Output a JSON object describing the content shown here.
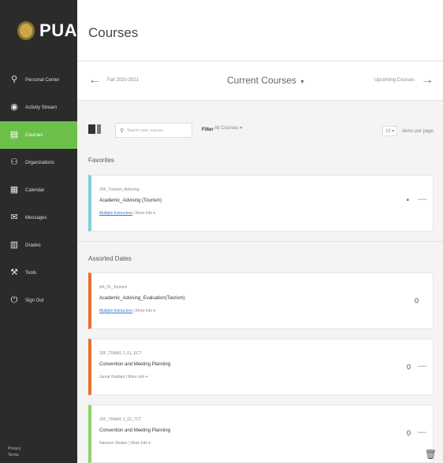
{
  "sidebar": {
    "logo_text": "PUA",
    "items": [
      {
        "label": "Personal Center",
        "icon": "person-icon",
        "glyph": "⚲"
      },
      {
        "label": "Activity Stream",
        "icon": "activity-icon",
        "glyph": "◉"
      },
      {
        "label": "Courses",
        "icon": "book-icon",
        "glyph": "▤"
      },
      {
        "label": "Organizations",
        "icon": "org-icon",
        "glyph": "⚇"
      },
      {
        "label": "Calendar",
        "icon": "calendar-icon",
        "glyph": "▦"
      },
      {
        "label": "Messages",
        "icon": "mail-icon",
        "glyph": "✉"
      },
      {
        "label": "Grades",
        "icon": "grades-icon",
        "glyph": "▥"
      },
      {
        "label": "Tools",
        "icon": "tools-icon",
        "glyph": "⚒"
      },
      {
        "label": "Sign Out",
        "icon": "signout-icon",
        "glyph": "⏻"
      }
    ],
    "footer_line1": "Privacy",
    "footer_line2": "Terms"
  },
  "header": {
    "title": "Courses"
  },
  "termbar": {
    "prev_label": "Fall 2020-2021",
    "current_label": "Current Courses",
    "next_label": "Upcoming Courses"
  },
  "toolbar": {
    "search_placeholder": "Search your courses",
    "filter_label": "Filter",
    "filter_value": "All Courses ▾",
    "per_page_count": "10 ▾",
    "per_page_label": "items per page"
  },
  "sections": {
    "favorites_title": "Favorites",
    "assorted_title": "Assorted Dates"
  },
  "courses": [
    {
      "code": "20F_Tourism_Advising",
      "name": "Academic_Advising (Tourism)",
      "meta_link": "Multiple Instructors",
      "meta_more": "| More Info ▾",
      "num": "",
      "accent": "#7fd0d8",
      "fav": true
    },
    {
      "code": "AA_01_Tourism",
      "name": "Academic_Advising_Evaluation(Tourism)",
      "meta_link": "Multiple Instructors",
      "meta_more": "| More Info ▾",
      "num": "0",
      "accent": "#e8702a",
      "fav": false
    },
    {
      "code": "20F_TRAM1.1_01_ECT",
      "name": "Convention and Meeting Planning",
      "meta_link": "",
      "meta_more": "Jamal Haddad | More Info ▾",
      "num": "0",
      "accent": "#e8702a",
      "fav": false
    },
    {
      "code": "20F_TRAM1.1_02_TCT",
      "name": "Convention and Meeting Planning",
      "meta_link": "",
      "meta_more": "Naseem Shaker | More Info ▾",
      "num": "0",
      "accent": "#8fd06a",
      "fav": false
    }
  ],
  "colors": {
    "sidebar_bg": "#2b2b2b",
    "active_green": "#6cc04a",
    "favorite_star": "#9b59b6"
  }
}
